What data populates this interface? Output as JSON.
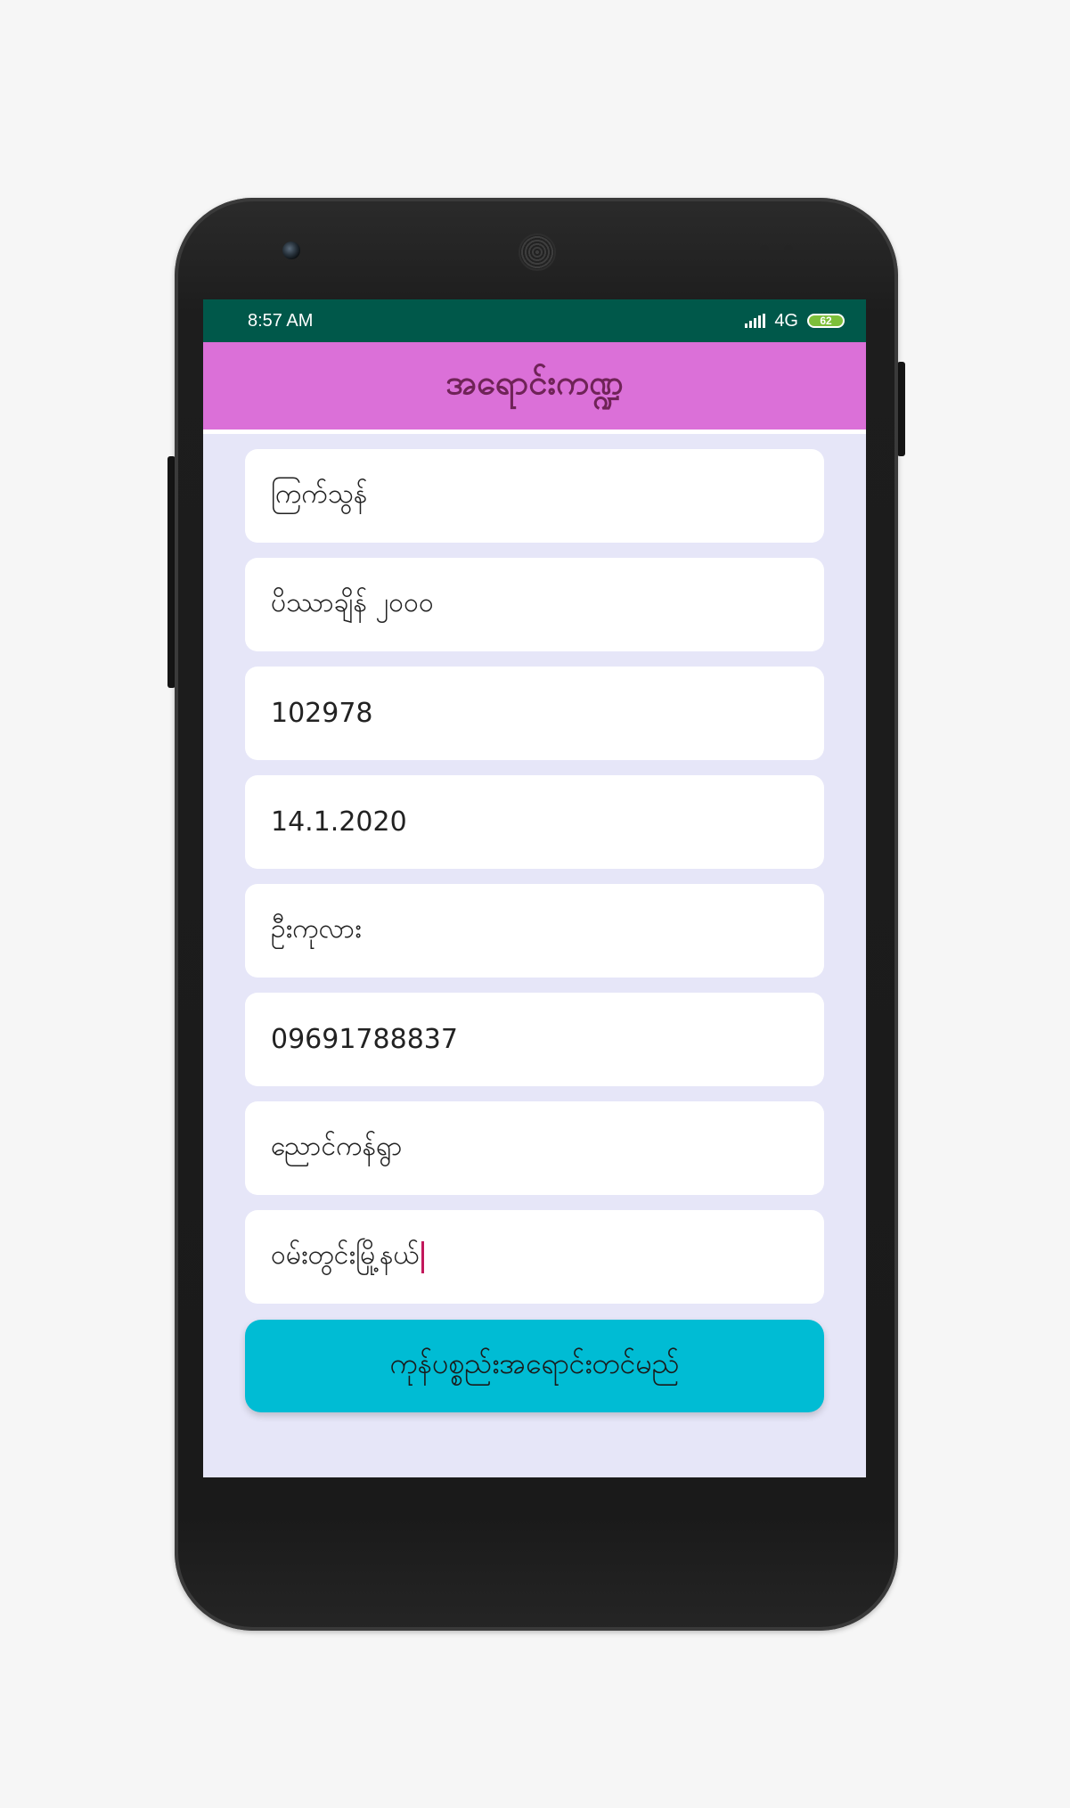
{
  "statusbar": {
    "time": "8:57 AM",
    "network": "4G",
    "battery": "62"
  },
  "appbar": {
    "title": "အရောင်းကဏ္ဍ"
  },
  "form": {
    "fields": [
      {
        "value": "ကြက်သွန်"
      },
      {
        "value": "ပိဿာချိန် ၂၀၀၀"
      },
      {
        "value": "102978"
      },
      {
        "value": "14.1.2020"
      },
      {
        "value": "ဦးကုလား"
      },
      {
        "value": "09691788837"
      },
      {
        "value": "ညောင်ကန်ရွာ"
      },
      {
        "value": "ဝမ်းတွင်းမြို့နယ်"
      }
    ],
    "submit_label": "ကုန်ပစ္စည်းအရောင်းတင်မည်"
  },
  "colors": {
    "statusbar": "#00584a",
    "appbar": "#db70d8",
    "title_text": "#6f2357",
    "screen_bg": "#e6e6f8",
    "button": "#00bcd4",
    "cursor": "#c2185b"
  }
}
